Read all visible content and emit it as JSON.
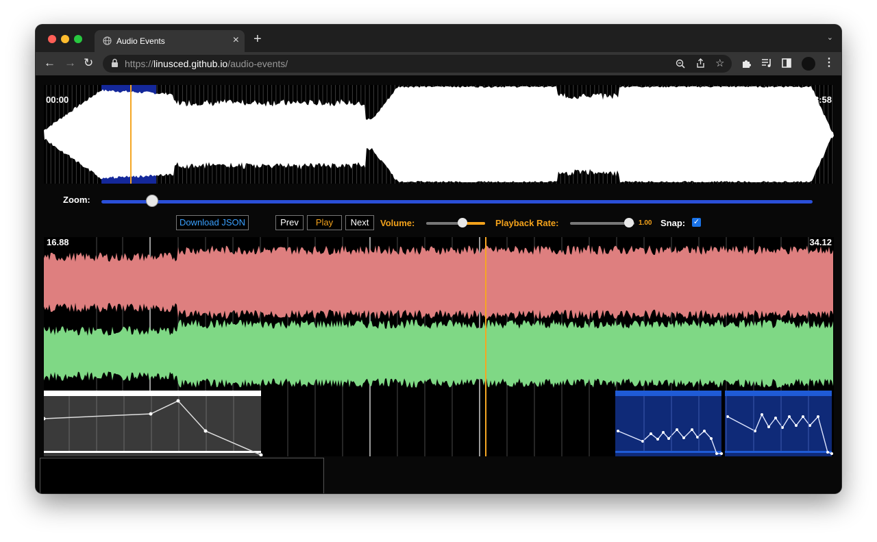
{
  "browser": {
    "tab_title": "Audio Events",
    "tab_close": "×",
    "new_tab": "+",
    "tab_menu": "⌄",
    "url_scheme": "https://",
    "url_host": "linusced.github.io",
    "url_path": "/audio-events/"
  },
  "overview": {
    "time_start": "00:00",
    "time_end": "03:58",
    "playhead_color": "#f5a623",
    "selection_color": "#14289a"
  },
  "controls": {
    "zoom_label": "Zoom:",
    "zoom_level": 0.07,
    "download_label": "Download JSON",
    "prev_label": "Prev",
    "play_label": "Play",
    "next_label": "Next",
    "volume_label": "Volume:",
    "volume_level": 0.62,
    "rate_label": "Playback Rate:",
    "rate_value": "1.00",
    "snap_label": "Snap:",
    "snap_checked": true
  },
  "detail": {
    "time_start": "16.88",
    "time_end": "34.12",
    "channel_top_color": "#de7f7f",
    "channel_bottom_color": "#7fd885",
    "playhead_color": "#f5a623"
  },
  "events": {
    "white_event_color": "#ffffff",
    "blue_event_color": "#1f5bd6"
  }
}
